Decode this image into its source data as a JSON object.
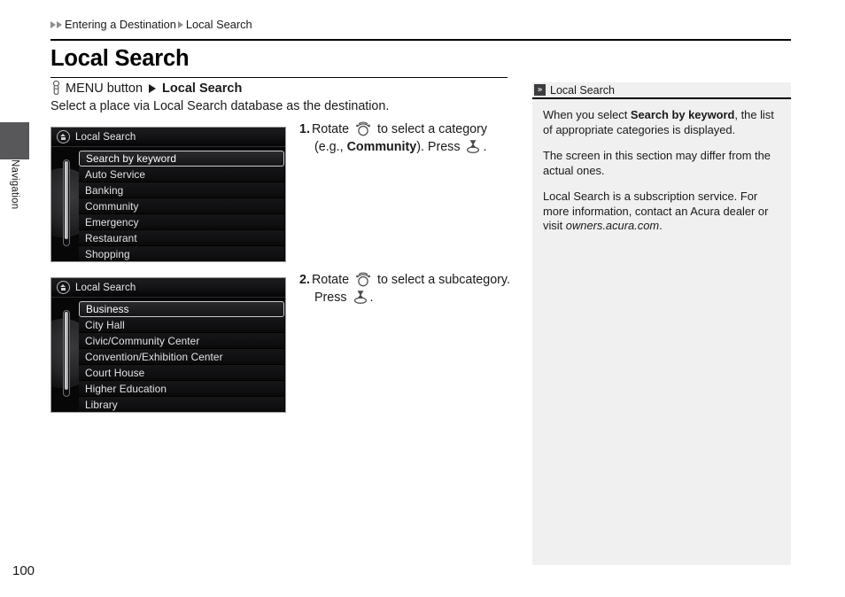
{
  "sidebar_tab": {
    "label": "Navigation"
  },
  "breadcrumb": {
    "item1": "Entering a Destination",
    "item2": "Local Search"
  },
  "header": {
    "title": "Local Search"
  },
  "menu_path": {
    "button_label": "MENU button",
    "target": "Local Search",
    "icon": "finger-press-icon",
    "arrow_icon": "triangle-right-icon"
  },
  "intro": {
    "text": "Select a place via Local Search database as the destination."
  },
  "screens": [
    {
      "name": "local-search-categories",
      "title": "Local Search",
      "icon": "home-icon",
      "items": [
        "Search by keyword",
        "Auto Service",
        "Banking",
        "Community",
        "Emergency",
        "Restaurant",
        "Shopping"
      ],
      "selected_index": 0
    },
    {
      "name": "local-search-subcategories",
      "title": "Local Search",
      "icon": "home-icon",
      "items": [
        "Business",
        "City Hall",
        "Civic/Community Center",
        "Convention/Exhibition Center",
        "Court House",
        "Higher Education",
        "Library"
      ],
      "selected_index": 0
    }
  ],
  "steps": [
    {
      "number": "1.",
      "line1_pre": "Rotate",
      "line1_post": "to select a category",
      "line2_pre": "(e.g.,",
      "line2_bold": "Community",
      "line2_mid": "). Press",
      "line2_post": ".",
      "rotate_icon": "rotate-knob-icon",
      "press_icon": "press-knob-icon"
    },
    {
      "number": "2.",
      "line1_pre": "Rotate",
      "line1_post": "to select a subcategory.",
      "line2_pre": "Press",
      "line2_post": ".",
      "rotate_icon": "rotate-knob-icon",
      "press_icon": "press-knob-icon"
    }
  ],
  "note": {
    "icon": "double-chevron-right-icon",
    "title": "Local Search",
    "paragraphs": [
      {
        "pre": "When you select ",
        "bold": "Search by keyword",
        "post": ", the list of appropriate categories is displayed."
      },
      {
        "pre": "The screen in this section may differ from the actual ones.",
        "bold": "",
        "post": ""
      },
      {
        "pre": "Local Search is a subscription service. For more information, contact an Acura dealer or visit ",
        "italic": "owners.acura.com",
        "post": "."
      }
    ]
  },
  "footer": {
    "page_number": "100"
  },
  "colors": {
    "edge_tab": "#58585a",
    "note_panel": "#f0f0f0",
    "screen_bg": "#070708",
    "rule": "#000000"
  }
}
